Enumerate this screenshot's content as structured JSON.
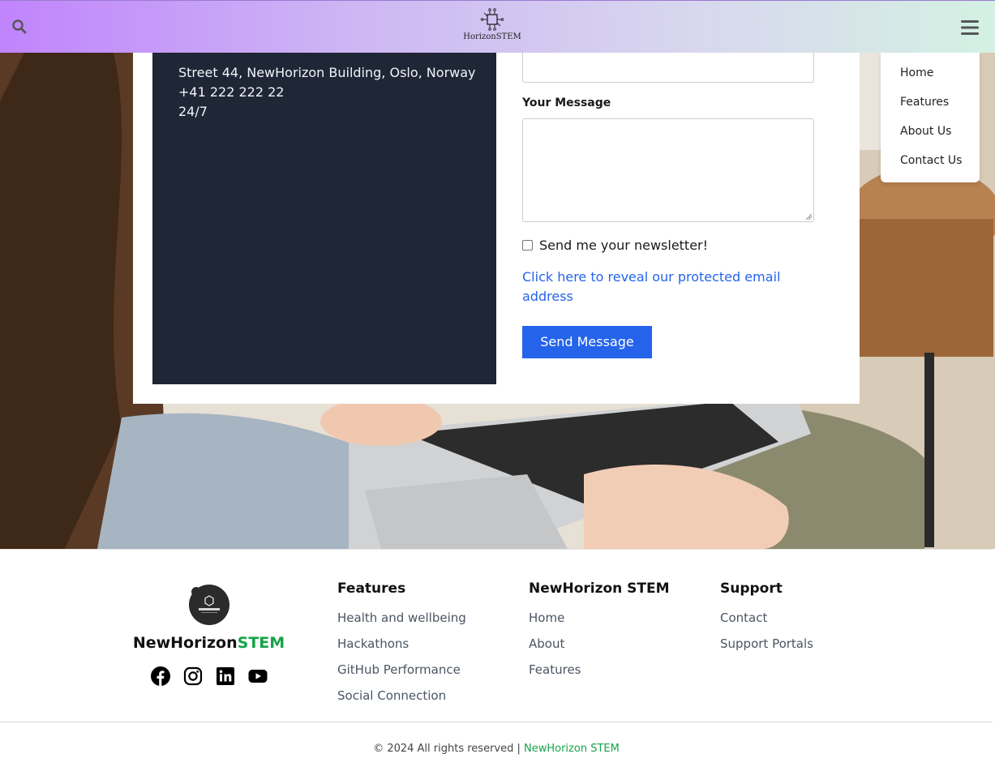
{
  "header": {
    "logo_text": "HorizonSTEM"
  },
  "contact": {
    "address": "Street 44, NewHorizon Building, Oslo, Norway",
    "phone": "+41 222 222 22",
    "hours": "24/7",
    "message_label": "Your Message",
    "newsletter_label": "Send me your newsletter!",
    "newsletter_checked": false,
    "reveal_email_link": "Click here to reveal our protected email address",
    "send_button": "Send Message"
  },
  "nav_dropdown": {
    "items": [
      "Home",
      "Features",
      "About Us",
      "Contact Us"
    ]
  },
  "footer": {
    "brand_name_main": "NewHorizon",
    "brand_name_accent": "STEM",
    "social_icons": [
      "facebook-icon",
      "instagram-icon",
      "linkedin-icon",
      "youtube-icon"
    ],
    "columns": [
      {
        "title": "Features",
        "links": [
          "Health and wellbeing",
          "Hackathons",
          "GitHub Performance",
          "Social Connection"
        ]
      },
      {
        "title": "NewHorizon STEM",
        "links": [
          "Home",
          "About",
          "Features"
        ]
      },
      {
        "title": "Support",
        "links": [
          "Contact",
          "Support Portals"
        ]
      }
    ],
    "copyright_text": "© 2024 All rights reserved | ",
    "copyright_link": "NewHorizon STEM"
  },
  "colors": {
    "accent_green": "#16a34a",
    "primary_blue": "#2563eb",
    "info_panel_bg": "#1f2636",
    "header_gradient_start": "#c084fc",
    "header_gradient_end": "#d4f1e3"
  }
}
